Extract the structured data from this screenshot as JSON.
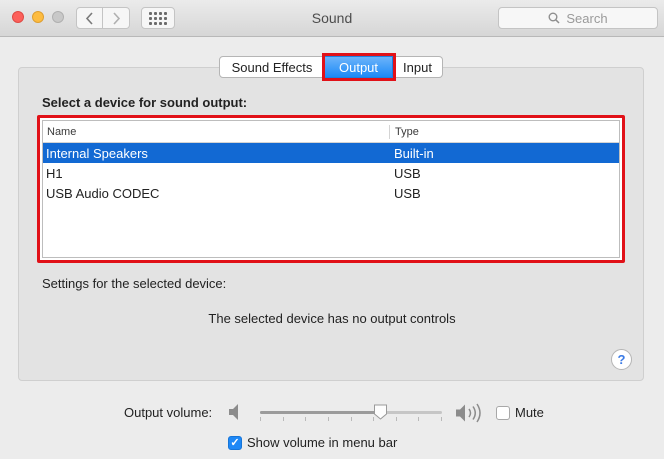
{
  "window": {
    "title": "Sound"
  },
  "toolbar": {
    "back_icon": "chevron-left-icon",
    "forward_icon": "chevron-right-icon",
    "grid_icon": "grid-icon",
    "search_placeholder": "Search"
  },
  "tabs": [
    {
      "label": "Sound Effects",
      "selected": false
    },
    {
      "label": "Output",
      "selected": true
    },
    {
      "label": "Input",
      "selected": false
    }
  ],
  "output": {
    "heading": "Select a device for sound output:",
    "columns": {
      "name": "Name",
      "type": "Type"
    },
    "devices": [
      {
        "name": "Internal Speakers",
        "type": "Built-in",
        "selected": true
      },
      {
        "name": "H1",
        "type": "USB",
        "selected": false
      },
      {
        "name": "USB Audio CODEC",
        "type": "USB",
        "selected": false
      }
    ],
    "settings_label": "Settings for the selected device:",
    "no_controls_text": "The selected device has no output controls"
  },
  "help": {
    "label": "?"
  },
  "volume": {
    "label": "Output volume:",
    "level": 0.66,
    "mute_label": "Mute",
    "mute_checked": false,
    "show_in_menu_bar_label": "Show volume in menu bar",
    "show_in_menu_bar_checked": true
  },
  "colors": {
    "accent": "#1e88f6",
    "selection": "#1269d3",
    "highlight_border": "#e11118"
  }
}
